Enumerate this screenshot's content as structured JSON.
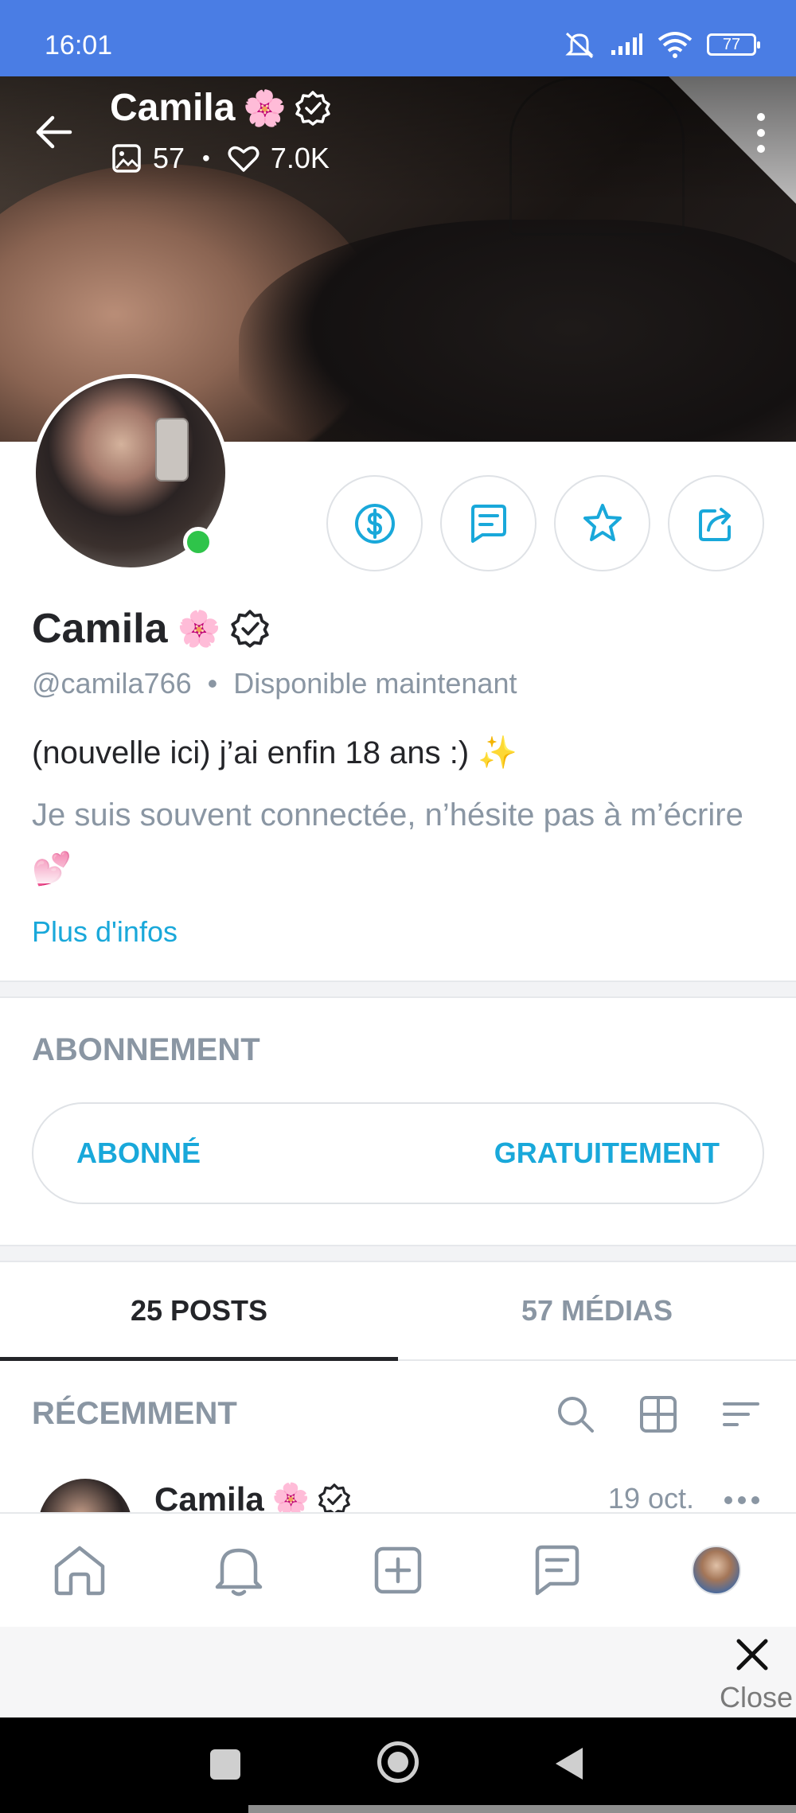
{
  "status_bar": {
    "time": "16:01",
    "battery": "77",
    "background": "#4a7de4"
  },
  "header": {
    "name": "Camila",
    "name_emoji": "🌸",
    "photos_count": "57",
    "likes_count": "7.0K"
  },
  "profile": {
    "name": "Camila",
    "name_emoji": "🌸",
    "handle": "@camila766",
    "separator": "•",
    "availability": "Disponible maintenant",
    "bio_line1": "(nouvelle ici) j’ai enfin 18 ans :) ✨",
    "bio_line2": "Je suis souvent connectée, n’hésite pas à m’écrire 💕",
    "more_info": "Plus d'infos",
    "online": true
  },
  "actions": {
    "icons": [
      "dollar-icon",
      "message-icon",
      "star-icon",
      "share-icon"
    ]
  },
  "subscription": {
    "title": "ABONNEMENT",
    "status": "ABONNÉ",
    "price": "GRATUITEMENT"
  },
  "tabs": [
    {
      "label": "25 POSTS",
      "active": true
    },
    {
      "label": "57 MÉDIAS",
      "active": false
    }
  ],
  "recent": {
    "title": "RÉCEMMENT"
  },
  "post_preview": {
    "author": "Camila",
    "author_emoji": "🌸",
    "date": "19 oct."
  },
  "bottom_nav": {
    "items": [
      "home-icon",
      "bell-icon",
      "add-icon",
      "messages-icon",
      "profile-avatar"
    ]
  },
  "close_bar": {
    "label": "Close"
  },
  "colors": {
    "accent": "#19a8da",
    "text_primary": "#242529",
    "text_secondary": "#8a96a3",
    "online": "#2fc44a"
  }
}
